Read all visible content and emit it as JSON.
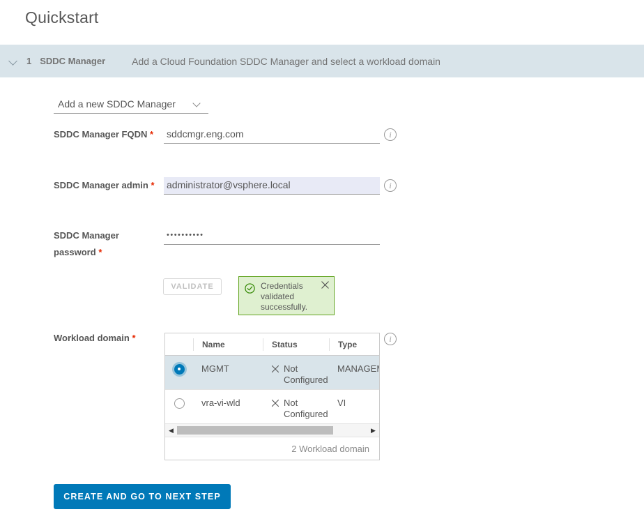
{
  "page": {
    "title": "Quickstart"
  },
  "step": {
    "chevron_icon": "chevron-down-icon",
    "number": "1",
    "label": "SDDC Manager",
    "description": "Add a Cloud Foundation SDDC Manager and select a workload domain"
  },
  "form": {
    "manager_select": {
      "value": "Add a new SDDC Manager",
      "caret_icon": "chevron-down-icon"
    },
    "fqdn": {
      "label": "SDDC Manager FQDN",
      "required_mark": "*",
      "value": "sddcmgr.eng.com",
      "placeholder": "",
      "info_icon": "info-circle-icon"
    },
    "admin": {
      "label": "SDDC Manager admin",
      "required_mark": "*",
      "value": "administrator@vsphere.local",
      "placeholder": "",
      "info_icon": "info-circle-icon"
    },
    "password": {
      "label": "SDDC Manager password",
      "required_mark": "*",
      "value": "••••••••••",
      "placeholder": ""
    },
    "validate_button": "VALIDATE",
    "alert": {
      "icon": "check-circle-icon",
      "message": "Credentials validated successfully.",
      "close_icon": "close-icon"
    }
  },
  "workload_domain": {
    "label": "Workload domain",
    "required_mark": "*",
    "info_icon": "info-circle-icon",
    "columns": [
      "",
      "Name",
      "Status",
      "Type"
    ],
    "rows": [
      {
        "selected": true,
        "name": "MGMT",
        "status": "Not Configured",
        "status_icon": "close-x-icon",
        "type": "MANAGEMENT"
      },
      {
        "selected": false,
        "name": "vra-vi-wld",
        "status": "Not Configured",
        "status_icon": "close-x-icon",
        "type": "VI"
      }
    ],
    "footer": "2 Workload domain",
    "scroll_left_icon": "scroll-left-arrow-icon",
    "scroll_right_icon": "scroll-right-arrow-icon"
  },
  "actions": {
    "create_button": "CREATE AND GO TO NEXT STEP"
  },
  "colors": {
    "accent": "#0079b8",
    "band": "#d9e4ea",
    "success_bg": "#dff0d0",
    "success_border": "#62a420",
    "required": "#e62700",
    "highlight_field": "#e8eaf6"
  }
}
